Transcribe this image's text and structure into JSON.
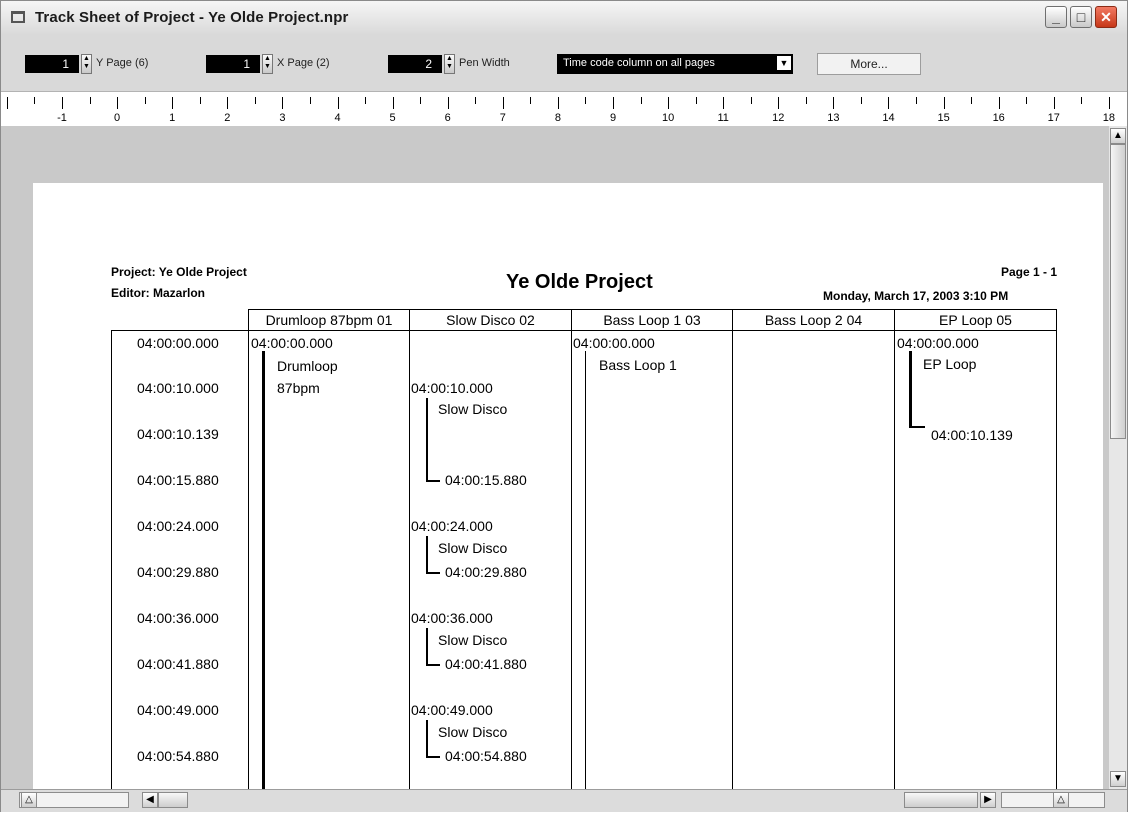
{
  "window": {
    "title": "Track Sheet of Project - Ye Olde Project.npr",
    "controls": [
      "_",
      "□",
      "✕"
    ]
  },
  "toolbar": {
    "y_page_value": "1",
    "y_page_label": "Y Page (6)",
    "x_page_value": "1",
    "x_page_label": "X Page (2)",
    "pen_width_value": "2",
    "pen_width_label": "Pen Width",
    "timecode_option": "Time code column on all pages",
    "more_label": "More..."
  },
  "ruler": {
    "labels": [
      "-1",
      "0",
      "1",
      "2",
      "3",
      "4",
      "5",
      "6",
      "7",
      "8",
      "9",
      "10",
      "11",
      "12",
      "13",
      "14",
      "15",
      "16",
      "17",
      "18"
    ]
  },
  "sheet": {
    "project_line": "Project: Ye Olde Project",
    "editor_line": "Editor: Mazarlon",
    "title": "Ye Olde Project",
    "page_label": "Page 1 - 1",
    "date_line": "Monday, March 17, 2003  3:10 PM",
    "columns": [
      "Drumloop 87bpm 01",
      "Slow Disco 02",
      "Bass Loop 1 03",
      "Bass Loop 2 04",
      "EP Loop 05"
    ],
    "timecodes": [
      "04:00:00.000",
      "04:00:10.000",
      "04:00:10.139",
      "04:00:15.880",
      "04:00:24.000",
      "04:00:29.880",
      "04:00:36.000",
      "04:00:41.880",
      "04:00:49.000",
      "04:00:54.880"
    ],
    "drumloop": {
      "start": "04:00:00.000",
      "name_line1": "Drumloop",
      "name_line2": "87bpm"
    },
    "slow_disco_events": [
      {
        "start": "04:00:10.000",
        "name": "Slow Disco",
        "end": "04:00:15.880"
      },
      {
        "start": "04:00:24.000",
        "name": "Slow Disco",
        "end": "04:00:29.880"
      },
      {
        "start": "04:00:36.000",
        "name": "Slow Disco",
        "end": "04:00:41.880"
      },
      {
        "start": "04:00:49.000",
        "name": "Slow Disco",
        "end": "04:00:54.880"
      }
    ],
    "bass_loop": {
      "start": "04:00:00.000",
      "name": "Bass Loop 1"
    },
    "ep_loop": {
      "start": "04:00:00.000",
      "name": "EP Loop",
      "end": "04:00:10.139"
    }
  },
  "colors": {
    "window_bg": "#d4d0c8",
    "page_bg": "#ffffff",
    "viewport_bg": "#c9c9c9",
    "close_button": "#c63718"
  }
}
